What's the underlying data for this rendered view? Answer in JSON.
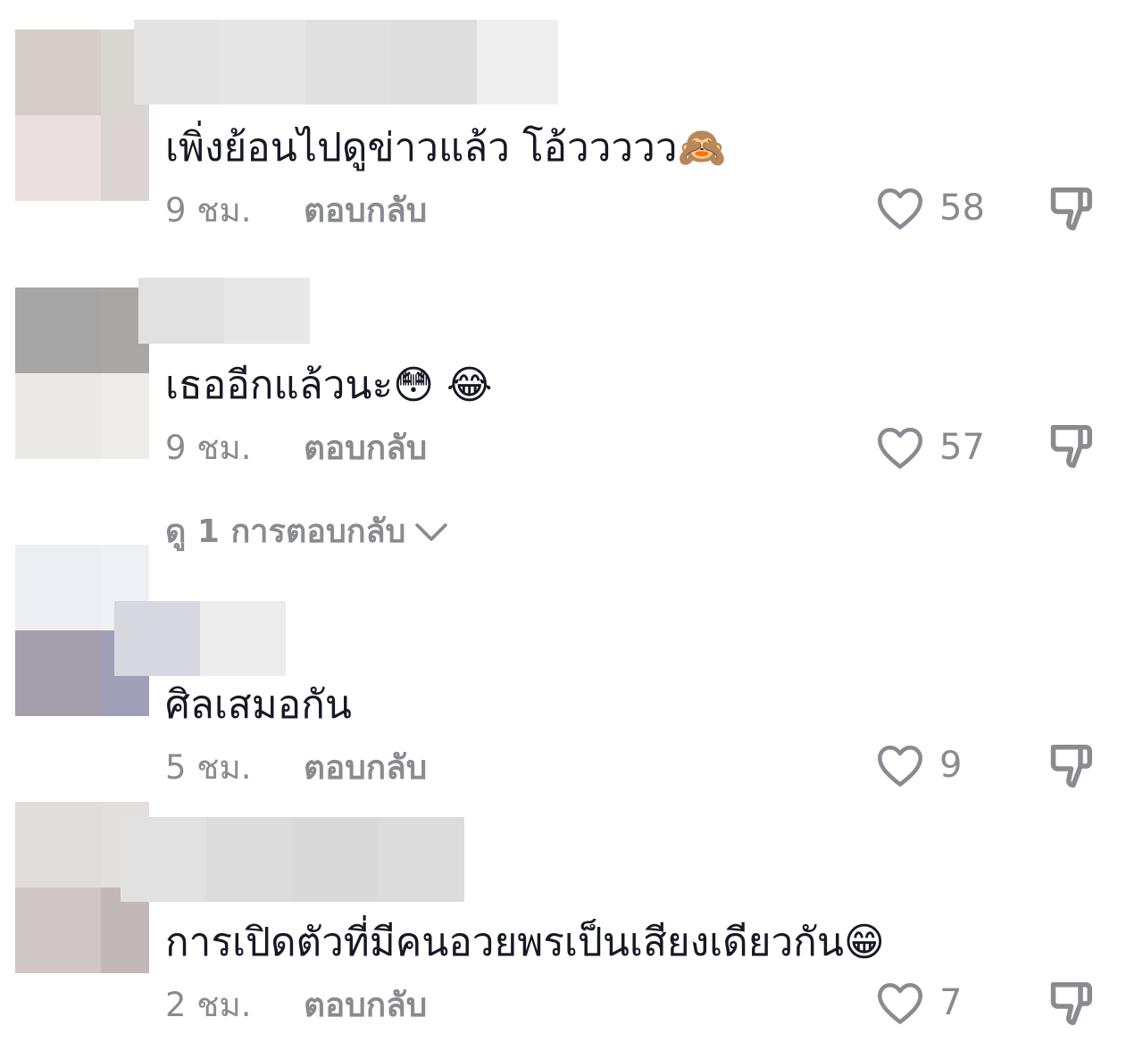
{
  "colors": {
    "text_primary": "#161823",
    "text_secondary": "#8a8b91",
    "background": "#ffffff"
  },
  "comments": [
    {
      "text": "เพิ่งย้อนไปดูข่าวแล้ว โอ้ววววว🙈",
      "time": "9 ชม.",
      "reply_label": "ตอบกลับ",
      "likes": "58"
    },
    {
      "text": "เธออีกแล้วนะ😳 😂",
      "time": "9 ชม.",
      "reply_label": "ตอบกลับ",
      "likes": "57",
      "view_replies": "ดู 1 การตอบกลับ"
    },
    {
      "text": "ศิลเสมอกัน",
      "time": "5 ชม.",
      "reply_label": "ตอบกลับ",
      "likes": "9"
    },
    {
      "text": "การเปิดตัวที่มีคนอวยพรเป็นเสียงเดียวกัน😁",
      "time": "2 ชม.",
      "reply_label": "ตอบกลับ",
      "likes": "7"
    }
  ],
  "icons": {
    "like": "heart-outline-icon",
    "dislike": "thumbs-down-outline-icon",
    "expand": "chevron-down-icon"
  }
}
